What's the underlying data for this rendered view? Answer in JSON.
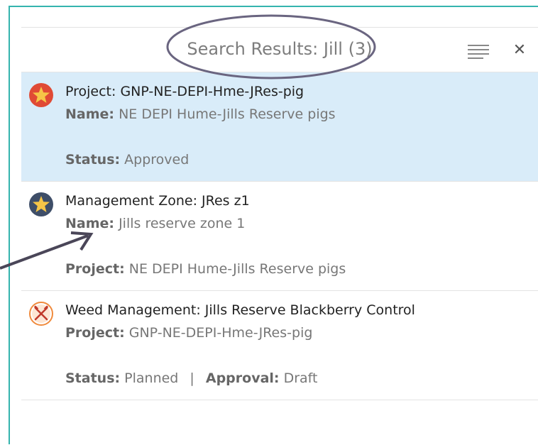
{
  "header": {
    "title": "Search Results: Jill (3)"
  },
  "results": [
    {
      "title": "Project: GNP-NE-DEPI-Hme-JRes-pig",
      "line1_label": "Name:",
      "line1_value": "NE DEPI Hume-Jills Reserve pigs",
      "line2_label": "Status:",
      "line2_value": "Approved",
      "icon": "star-icon",
      "icon_color": "#e04a35"
    },
    {
      "title": "Management Zone: JRes z1",
      "line1_label": "Name:",
      "line1_value": "Jills reserve zone 1",
      "line2_label": "Project:",
      "line2_value": "NE DEPI Hume-Jills Reserve pigs",
      "icon": "star-icon",
      "icon_color": "#3e4e68"
    },
    {
      "title": "Weed Management: Jills Reserve Blackberry Control",
      "line1_label": "Project:",
      "line1_value": "GNP-NE-DEPI-Hme-JRes-pig",
      "line2_label": "Status:",
      "line2_value": "Planned",
      "line2_sep": "|",
      "line2b_label": "Approval:",
      "line2b_value": "Draft",
      "icon": "crossed-tools-icon",
      "icon_color": "#f08a3c"
    }
  ],
  "colors": {
    "accent_frame": "#35b4ae",
    "selected_row": "#d9ecf9",
    "annotation": "#6a6580"
  }
}
